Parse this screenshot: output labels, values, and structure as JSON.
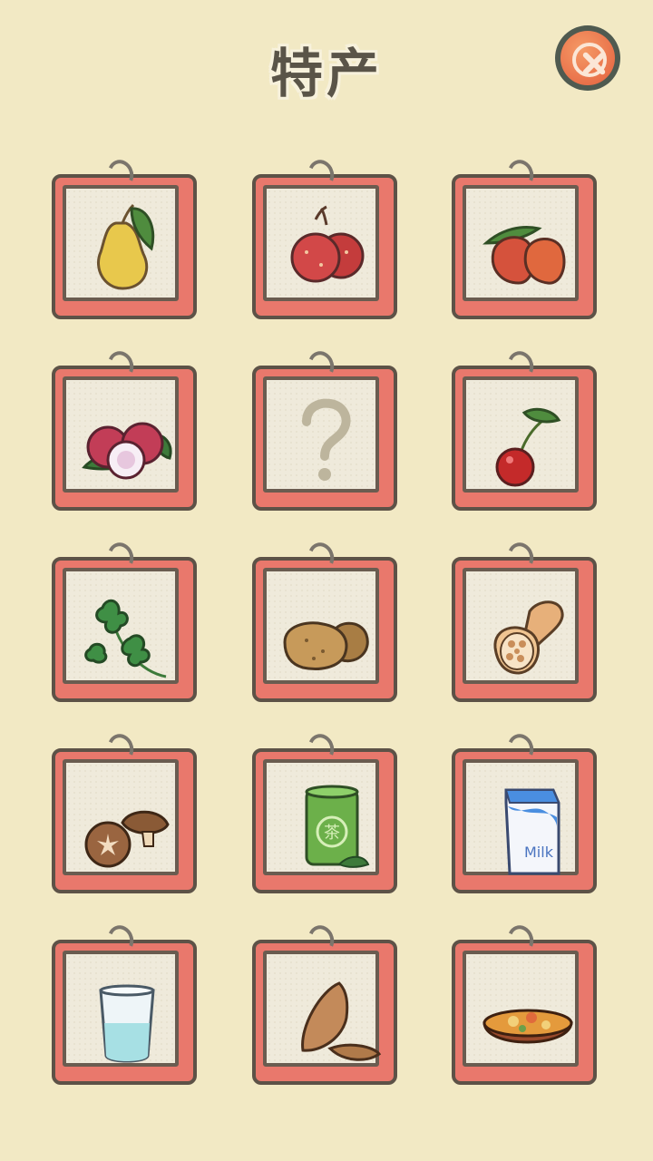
{
  "header": {
    "title": "特产",
    "close_icon": "close-icon"
  },
  "collection": {
    "items": [
      {
        "icon": "pear-icon"
      },
      {
        "icon": "hawthorn-icon"
      },
      {
        "icon": "jujube-icon"
      },
      {
        "icon": "lychee-icon"
      },
      {
        "icon": "question-mark-icon",
        "locked": true
      },
      {
        "icon": "cherry-icon"
      },
      {
        "icon": "coriander-icon"
      },
      {
        "icon": "potato-icon"
      },
      {
        "icon": "lotus-root-icon"
      },
      {
        "icon": "shiitake-mushroom-icon"
      },
      {
        "icon": "tea-can-icon",
        "label": "茶"
      },
      {
        "icon": "milk-carton-icon",
        "label": "Milk"
      },
      {
        "icon": "water-glass-icon"
      },
      {
        "icon": "almond-icon"
      },
      {
        "icon": "stew-bowl-icon"
      }
    ]
  },
  "colors": {
    "background": "#f2e9c4",
    "frame": "#e9786c",
    "close_button": "#e9714a"
  }
}
